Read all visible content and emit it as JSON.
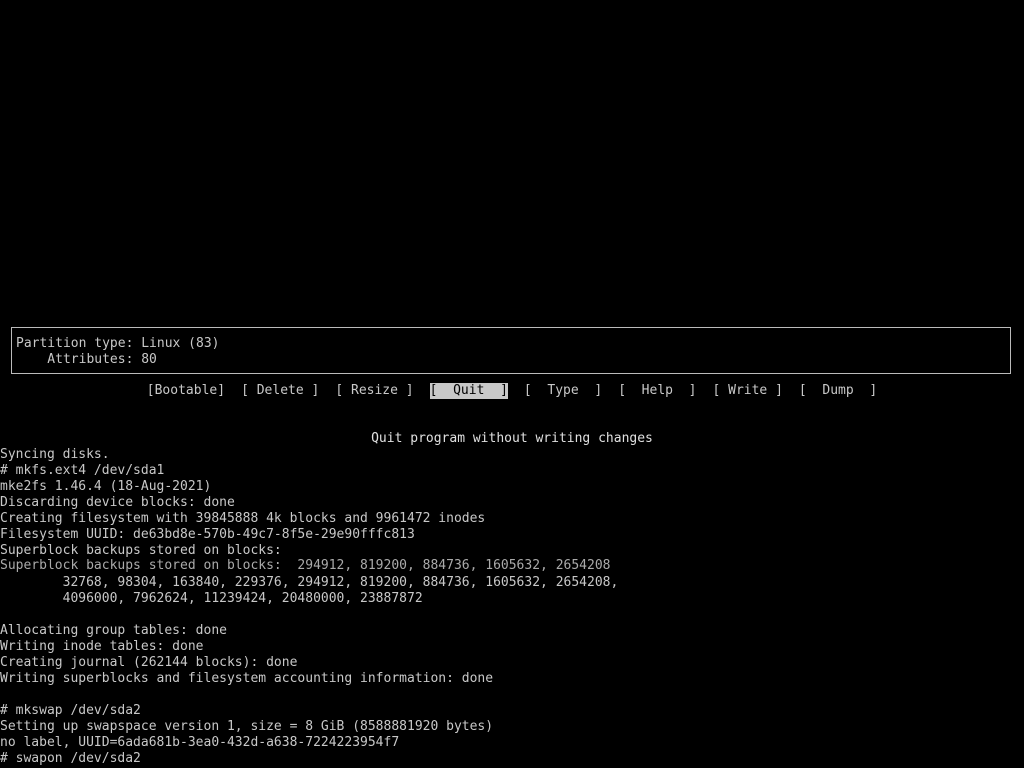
{
  "partition_info": {
    "type_line": "Partition type: Linux (83)",
    "attr_line": "    Attributes: 80"
  },
  "menu": {
    "bootable": "[Bootable]",
    "delete": "[ Delete ]",
    "resize": "[ Resize ]",
    "quit": "[  Quit  ]",
    "type": "[  Type  ]",
    "help": "[  Help  ]",
    "write": "[ Write ]",
    "dump": "[  Dump  ]",
    "selected": "quit"
  },
  "hint": "Quit program without writing changes",
  "garbled_overlap": "Superblock backups stored on blocks:  294912, 819200, 884736, 1605632, 2654208",
  "console": [
    "Syncing disks.",
    "# mkfs.ext4 /dev/sda1",
    "mke2fs 1.46.4 (18-Aug-2021)",
    "Discarding device blocks: done",
    "Creating filesystem with 39845888 4k blocks and 9961472 inodes",
    "Filesystem UUID: de63bd8e-570b-49c7-8f5e-29e90fffc813",
    "Superblock backups stored on blocks:",
    "",
    "        32768, 98304, 163840, 229376, 294912, 819200, 884736, 1605632, 2654208,",
    "        4096000, 7962624, 11239424, 20480000, 23887872",
    "",
    "Allocating group tables: done",
    "Writing inode tables: done",
    "Creating journal (262144 blocks): done",
    "Writing superblocks and filesystem accounting information: done",
    "",
    "# mkswap /dev/sda2",
    "Setting up swapspace version 1, size = 8 GiB (8588881920 bytes)",
    "no label, UUID=6ada681b-3ea0-432d-a638-7224223954f7",
    "# swapon /dev/sda2"
  ]
}
